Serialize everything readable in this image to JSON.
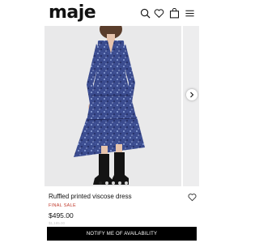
{
  "header": {
    "logo": "maje",
    "icons": [
      "search-icon",
      "heart-icon",
      "bag-icon",
      "menu-icon"
    ]
  },
  "gallery": {
    "image_count": 5,
    "active_index": 0,
    "next_icon": "chevron-right-icon"
  },
  "product": {
    "title": "Ruffled printed viscose dress",
    "badge": "FINAL SALE",
    "price": "$495.00",
    "strikethrough_price": "$1,185.00"
  },
  "cta": {
    "label": "NOTIFY ME OF AVAILABILITY"
  },
  "colors": {
    "sale_red": "#c0392b",
    "button_black": "#000000",
    "dress_blue": "#3b4c8f"
  }
}
